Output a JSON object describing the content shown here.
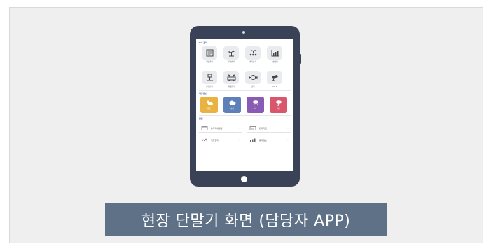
{
  "caption": "현장 단말기 화면 (담당자 APP)",
  "app": {
    "sections": {
      "menu_title": "IoT 관리",
      "weather_title": "기상정보",
      "list_title": "알림"
    },
    "menu_items": [
      {
        "label": "위생관리",
        "icon": "document-icon"
      },
      {
        "label": "환경센서",
        "icon": "plant-icon"
      },
      {
        "label": "생육센서",
        "icon": "sprout-icon"
      },
      {
        "label": "시설정보",
        "icon": "chart-icon"
      },
      {
        "label": "관수관리",
        "icon": "valve-icon"
      },
      {
        "label": "재배관리",
        "icon": "farm-icon"
      },
      {
        "label": "방제",
        "icon": "machine-icon"
      },
      {
        "label": "CCTV",
        "icon": "camera-icon"
      }
    ],
    "weather_items": [
      {
        "label": "맑음",
        "color": "#e8b341",
        "icon": "sun-cloud-icon"
      },
      {
        "label": "흐림",
        "color": "#5f7fb8",
        "icon": "cloud-icon"
      },
      {
        "label": "비",
        "color": "#8a5bb5",
        "icon": "rain-icon"
      },
      {
        "label": "태풍",
        "color": "#d9566d",
        "icon": "storm-icon"
      }
    ],
    "list_items": [
      {
        "label": "농가재배일정",
        "icon": "calendar-icon"
      },
      {
        "label": "관리카드",
        "icon": "card-icon"
      },
      {
        "label": "작업일지",
        "icon": "journal-icon"
      },
      {
        "label": "통계정보",
        "icon": "stats-icon"
      }
    ]
  },
  "colors": {
    "tablet_body": "#3a4257",
    "caption_bg": "#5f7187",
    "tile_bg": "#e9ebee"
  }
}
